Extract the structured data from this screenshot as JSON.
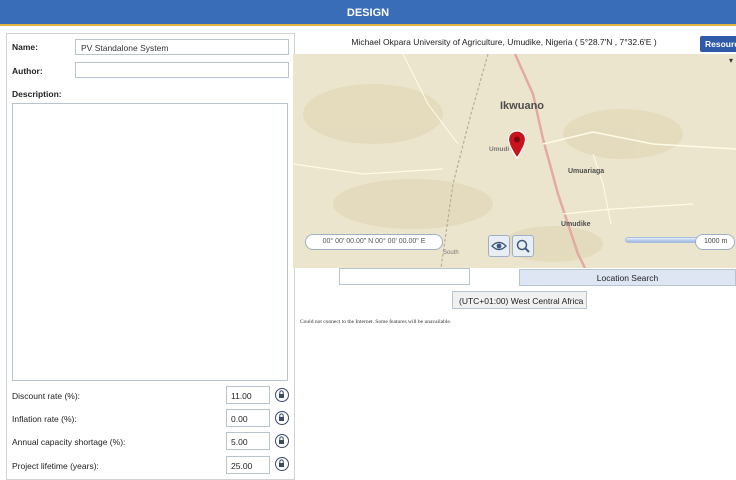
{
  "window": {
    "title": "DESIGN"
  },
  "form": {
    "name_label": "Name:",
    "name_value": "PV Standalone System",
    "author_label": "Author:",
    "author_value": "",
    "description_label": "Description:",
    "description_value": ""
  },
  "params": [
    {
      "label": "Discount rate (%):",
      "value": "11.00"
    },
    {
      "label": "Inflation rate (%):",
      "value": "0.00"
    },
    {
      "label": "Annual capacity shortage (%):",
      "value": "5.00"
    },
    {
      "label": "Project lifetime (years):",
      "value": "25.00"
    }
  ],
  "location": {
    "header": "Michael Okpara University of Agriculture, Umudike, Nigeria ( 5°28.7'N , 7°32.6'E )",
    "resource_button": "Resources",
    "search_value": "",
    "search_button": "Location Search",
    "timezone": "(UTC+01:00) West Central Africa",
    "offline_message": "Could not connect to the Internet. Some features will be unavailable."
  },
  "map": {
    "places": {
      "ikwuano": "Ikwuano",
      "umudike_small": "Umudi",
      "umuariaga": "Umuariaga",
      "umudike": "Umudike",
      "road": "South"
    },
    "coord_readout": "00° 00' 00.00\" N 00° 00' 00.00\" E",
    "scale_label": "1000 m",
    "icons": [
      "map-pin-icon",
      "eye-icon",
      "magnifier-icon",
      "lock-icon"
    ],
    "colors": {
      "pin": "#c8141e",
      "land": "#ece5cd",
      "road": "#e3a9a2",
      "title_bar": "#3a6db8",
      "title_accent": "#e3b341"
    }
  }
}
